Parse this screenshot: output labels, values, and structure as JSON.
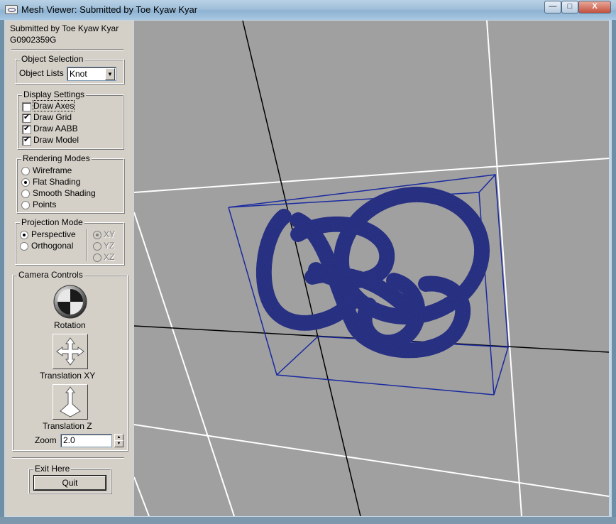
{
  "window": {
    "title": "Mesh Viewer: Submitted by Toe Kyaw Kyar",
    "controls": {
      "minimize": "—",
      "maximize": "□",
      "close": "X"
    }
  },
  "panel": {
    "author_line": "Submitted by Toe Kyaw Kyar",
    "student_id": "G0902359G",
    "object_selection": {
      "title": "Object Selection",
      "label": "Object Lists",
      "selected": "Knot"
    },
    "display_settings": {
      "title": "Display Settings",
      "items": [
        {
          "label": "Draw Axes",
          "checked": false
        },
        {
          "label": "Draw Grid",
          "checked": true
        },
        {
          "label": "Draw AABB",
          "checked": true
        },
        {
          "label": "Draw Model",
          "checked": true
        }
      ]
    },
    "rendering_modes": {
      "title": "Rendering Modes",
      "items": [
        {
          "label": "Wireframe",
          "selected": false
        },
        {
          "label": "Flat Shading",
          "selected": true
        },
        {
          "label": "Smooth Shading",
          "selected": false
        },
        {
          "label": "Points",
          "selected": false
        }
      ]
    },
    "projection_mode": {
      "title": "Projection Mode",
      "items": [
        {
          "label": "Perspective",
          "selected": true
        },
        {
          "label": "Orthogonal",
          "selected": false
        }
      ],
      "planes": [
        {
          "label": "XY",
          "selected": true
        },
        {
          "label": "YZ",
          "selected": false
        },
        {
          "label": "XZ",
          "selected": false
        }
      ]
    },
    "camera_controls": {
      "title": "Camera Controls",
      "rotation_label": "Rotation",
      "translation_xy_label": "Translation XY",
      "translation_z_label": "Translation Z",
      "zoom_label": "Zoom",
      "zoom_value": "2.0"
    },
    "exit": {
      "title": "Exit Here",
      "quit_label": "Quit"
    }
  },
  "viewport": {
    "model": "Knot",
    "background_color": "#a0a0a0",
    "model_color": "#2f3894",
    "aabb_color": "#1a2aa0",
    "grid_color": "#ffffff",
    "axis_color": "#000000"
  }
}
